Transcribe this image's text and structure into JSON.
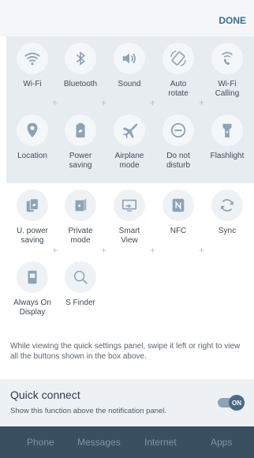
{
  "header": {
    "done_label": "DONE"
  },
  "panel_tiles": [
    {
      "icon": "wifi-icon",
      "label": "Wi-Fi"
    },
    {
      "icon": "bluetooth-icon",
      "label": "Bluetooth"
    },
    {
      "icon": "sound-icon",
      "label": "Sound"
    },
    {
      "icon": "auto-rotate-icon",
      "label": "Auto\nrotate"
    },
    {
      "icon": "wifi-calling-icon",
      "label": "Wi-Fi\nCalling"
    },
    {
      "icon": "location-icon",
      "label": "Location"
    },
    {
      "icon": "power-saving-icon",
      "label": "Power\nsaving"
    },
    {
      "icon": "airplane-icon",
      "label": "Airplane\nmode"
    },
    {
      "icon": "do-not-disturb-icon",
      "label": "Do not\ndisturb"
    },
    {
      "icon": "flashlight-icon",
      "label": "Flashlight"
    }
  ],
  "more_tiles": [
    {
      "icon": "ultra-power-saving-icon",
      "label": "U. power\nsaving"
    },
    {
      "icon": "private-mode-icon",
      "label": "Private\nmode"
    },
    {
      "icon": "smart-view-icon",
      "label": "Smart\nView"
    },
    {
      "icon": "nfc-icon",
      "label": "NFC"
    },
    {
      "icon": "sync-icon",
      "label": "Sync"
    },
    {
      "icon": "always-on-display-icon",
      "label": "Always On\nDisplay"
    },
    {
      "icon": "s-finder-icon",
      "label": "S Finder"
    }
  ],
  "hint_text": "While viewing the quick settings panel, swipe it left or right to view all the buttons shown in the box above.",
  "quick_connect": {
    "title": "Quick connect",
    "subtitle": "Show this function above the notification panel.",
    "toggle_label": "ON"
  },
  "bottom_nav": [
    "Phone",
    "Messages",
    "Internet",
    "Apps"
  ],
  "colors": {
    "accent": "#3b6f97",
    "icon": "#8da3b6",
    "panel": "#e7ecf1",
    "navbar": "#3a4f60"
  }
}
